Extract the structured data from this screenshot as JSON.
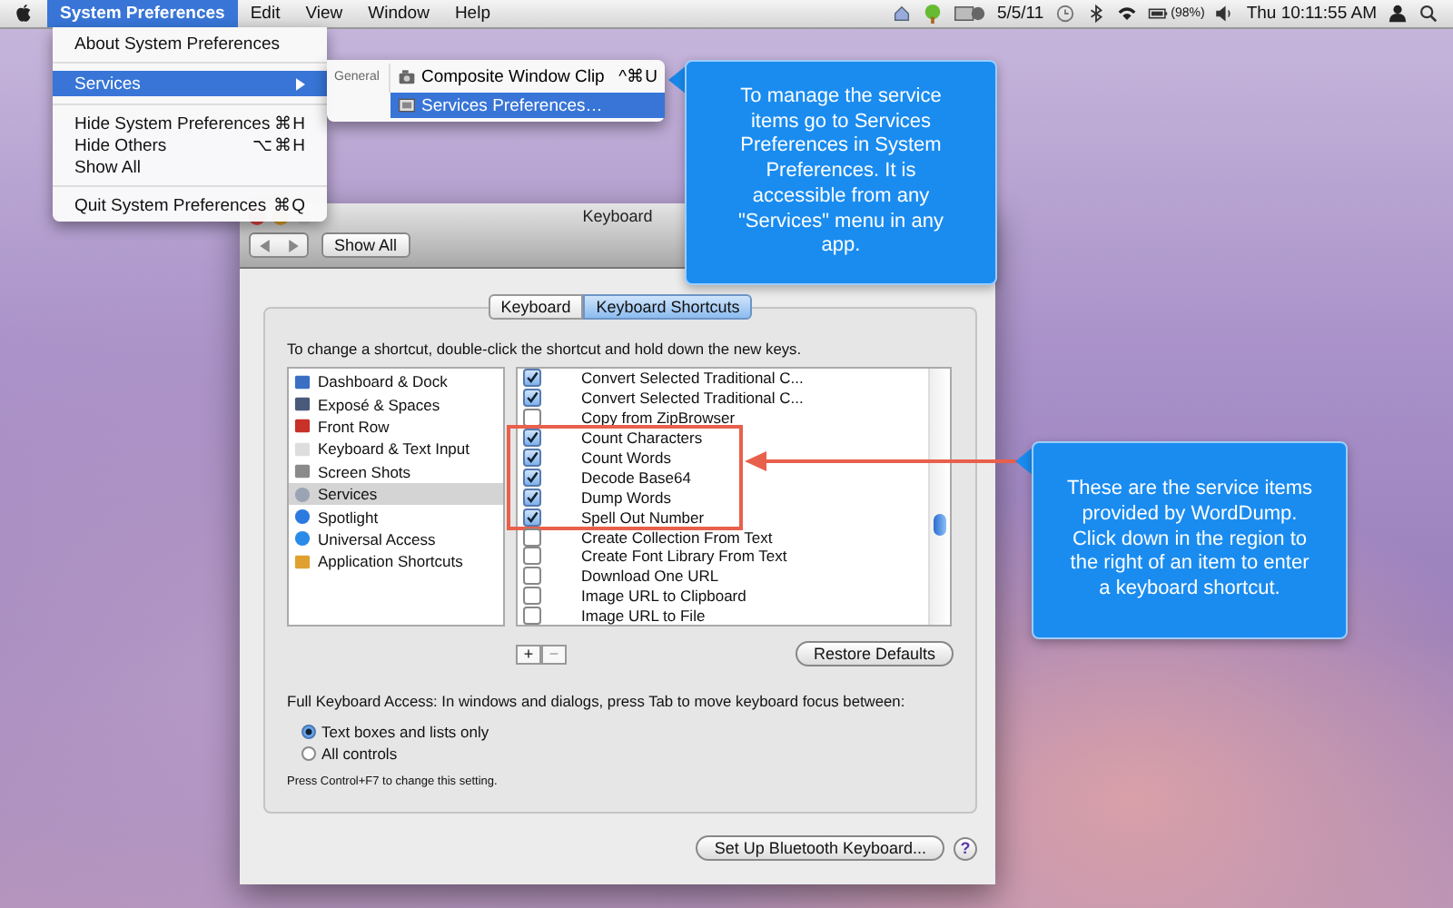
{
  "menu_bar": {
    "menus": [
      {
        "label": "System Preferences",
        "selected": true
      },
      {
        "label": "Edit",
        "selected": false
      },
      {
        "label": "View",
        "selected": false
      },
      {
        "label": "Window",
        "selected": false
      },
      {
        "label": "Help",
        "selected": false
      }
    ],
    "date": "5/5/11",
    "battery": "(98%)",
    "clock": "Thu 10:11:55 AM"
  },
  "app_menu": {
    "groups": [
      {
        "items": [
          {
            "label": "About System Preferences",
            "selected": false
          }
        ]
      },
      {
        "items": [
          {
            "label": "Services",
            "submenu": true,
            "selected": true
          }
        ]
      },
      {
        "items": [
          {
            "label": "Hide System Preferences",
            "shortcut": "⌘H",
            "selected": false
          },
          {
            "label": "Hide Others",
            "shortcut": "⌥⌘H",
            "selected": false
          },
          {
            "label": "Show All",
            "selected": false
          }
        ]
      },
      {
        "items": [
          {
            "label": "Quit System Preferences",
            "shortcut": "⌘Q",
            "selected": false
          }
        ]
      }
    ]
  },
  "services_submenu": {
    "section": "General",
    "items": [
      {
        "label": "Composite Window Clip",
        "shortcut": "^⌘U",
        "selected": false
      },
      {
        "label": "Services Preferences…",
        "selected": true
      }
    ]
  },
  "callouts": [
    {
      "text": "To manage the service items go to Services Preferences in System Preferences. It is accessible from any \"Services\" menu in any app."
    },
    {
      "text": "These are the service items provided by WordDump. Click down in the region to the right of an item to enter a keyboard shortcut."
    }
  ],
  "window": {
    "title": "Keyboard",
    "show_all": "Show All",
    "tabs": [
      {
        "label": "Keyboard",
        "selected": false
      },
      {
        "label": "Keyboard Shortcuts",
        "selected": true
      }
    ],
    "instructions": "To change a shortcut, double-click the shortcut and hold down the new keys.",
    "categories": [
      {
        "label": "Dashboard & Dock",
        "selected": false
      },
      {
        "label": "Exposé & Spaces",
        "selected": false
      },
      {
        "label": "Front Row",
        "selected": false
      },
      {
        "label": "Keyboard & Text Input",
        "selected": false
      },
      {
        "label": "Screen Shots",
        "selected": false
      },
      {
        "label": "Services",
        "selected": true
      },
      {
        "label": "Spotlight",
        "selected": false
      },
      {
        "label": "Universal Access",
        "selected": false
      },
      {
        "label": "Application Shortcuts",
        "selected": false
      }
    ],
    "services": [
      {
        "label": "Convert Selected Traditional C...",
        "checked": true
      },
      {
        "label": "Convert Selected Traditional C...",
        "checked": true
      },
      {
        "label": "Copy from ZipBrowser",
        "checked": false
      },
      {
        "label": "Count Characters",
        "checked": true,
        "highlighted": true
      },
      {
        "label": "Count Words",
        "checked": true,
        "highlighted": true
      },
      {
        "label": "Decode Base64",
        "checked": true,
        "highlighted": true
      },
      {
        "label": "Dump Words",
        "checked": true,
        "highlighted": true
      },
      {
        "label": "Spell Out Number",
        "checked": true,
        "highlighted": true
      },
      {
        "label": "Create Collection From Text",
        "checked": false
      },
      {
        "label": "Create Font Library From Text",
        "checked": false
      },
      {
        "label": "Download One URL",
        "checked": false
      },
      {
        "label": "Image URL to Clipboard",
        "checked": false
      },
      {
        "label": "Image URL to File",
        "checked": false
      }
    ],
    "add_button": "+",
    "remove_button": "−",
    "restore_button": "Restore Defaults",
    "full_keyboard_access": {
      "label": "Full Keyboard Access: In windows and dialogs, press Tab to move keyboard focus between:",
      "options": [
        {
          "label": "Text boxes and lists only",
          "selected": true
        },
        {
          "label": "All controls",
          "selected": false
        }
      ],
      "note": "Press Control+F7 to change this setting."
    },
    "bluetooth_button": "Set Up Bluetooth Keyboard...",
    "help_button": "?"
  }
}
